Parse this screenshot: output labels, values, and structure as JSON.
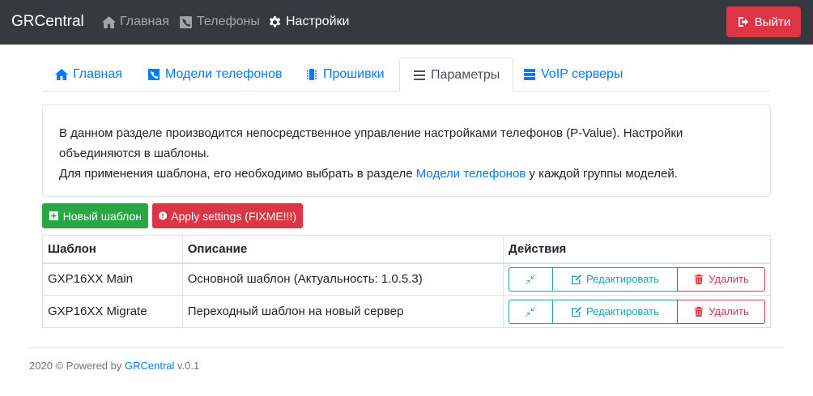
{
  "navbar": {
    "brand": "GRCentral",
    "links": [
      {
        "label": "Главная",
        "icon": "home-icon"
      },
      {
        "label": "Телефоны",
        "icon": "phone-square-icon"
      },
      {
        "label": "Настройки",
        "icon": "gear-icon"
      }
    ],
    "logout_label": "Выйти",
    "logout_icon": "sign-out-icon"
  },
  "tabs": [
    {
      "label": "Главная",
      "icon": "home-icon"
    },
    {
      "label": "Модели телефонов",
      "icon": "phone-square-icon"
    },
    {
      "label": "Прошивки",
      "icon": "microchip-icon"
    },
    {
      "label": "Параметры",
      "icon": "list-icon",
      "active": true
    },
    {
      "label": "VoIP серверы",
      "icon": "server-icon"
    }
  ],
  "info": {
    "line1": "В данном разделе производится непосредственное управление настройками телефонов (P-Value). Настройки объединяются в шаблоны.",
    "line2_prefix": "Для применения шаблона, его необходимо выбрать в разделе ",
    "line2_link": "Модели телефонов",
    "line2_suffix": " у каждой группы моделей."
  },
  "buttons": {
    "new_template": "Новый шаблон",
    "apply_settings": "Apply settings (FIXME!!!)"
  },
  "table": {
    "headers": [
      "Шаблон",
      "Описание",
      "Действия"
    ],
    "rows": [
      {
        "name": "GXP16XX Main",
        "description": "Основной шаблон (Актуальность: 1.0.5.3)",
        "edit": "Редактировать",
        "delete": "Удалить"
      },
      {
        "name": "GXP16XX Migrate",
        "description": "Переходный шаблон на новый сервер",
        "edit": "Редактировать",
        "delete": "Удалить"
      }
    ]
  },
  "footer": {
    "prefix": "2020 © Powered by ",
    "link": "GRCentral",
    "suffix": " v.0.1"
  },
  "colors": {
    "navbar": "#343a40",
    "primary": "#007bff",
    "danger": "#dc3545",
    "success": "#28a745",
    "info": "#17a2b8"
  }
}
